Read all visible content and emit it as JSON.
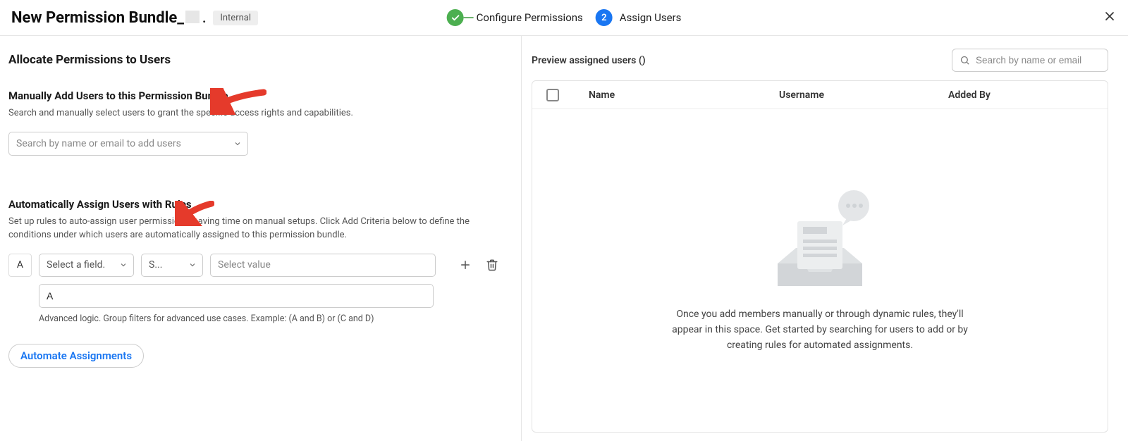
{
  "header": {
    "title_prefix": "New Permission Bundle_",
    "badge": "Internal"
  },
  "stepper": {
    "step1_label": "Configure Permissions",
    "step2_num": "2",
    "step2_label": "Assign Users"
  },
  "left": {
    "heading": "Allocate Permissions to Users",
    "manual_title": "Manually Add Users to this Permission Bundle",
    "manual_desc": "Search and manually select users to grant the specific access rights and capabilities.",
    "search_placeholder": "Search by name or email to add users",
    "auto_title": "Automatically Assign Users with Rules",
    "auto_desc": "Set up rules to auto-assign user permissions, saving time on manual setups. Click Add Criteria below to define the conditions under which users are automatically assigned to this permission bundle.",
    "rule": {
      "letter": "A",
      "field_placeholder": "Select a field.",
      "op_placeholder": "S...",
      "value_placeholder": "Select value",
      "logic_value": "A",
      "logic_hint": "Advanced logic. Group filters for advanced use cases. Example: (A and B) or (C and D)"
    },
    "automate_btn": "Automate Assignments"
  },
  "right": {
    "preview_title": "Preview assigned users ()",
    "search_placeholder": "Search by name or email",
    "columns": {
      "name": "Name",
      "username": "Username",
      "added_by": "Added By"
    },
    "empty_text": "Once you add members manually or through dynamic rules, they'll appear in this space. Get started by searching for users to add or by creating rules for automated assignments."
  }
}
